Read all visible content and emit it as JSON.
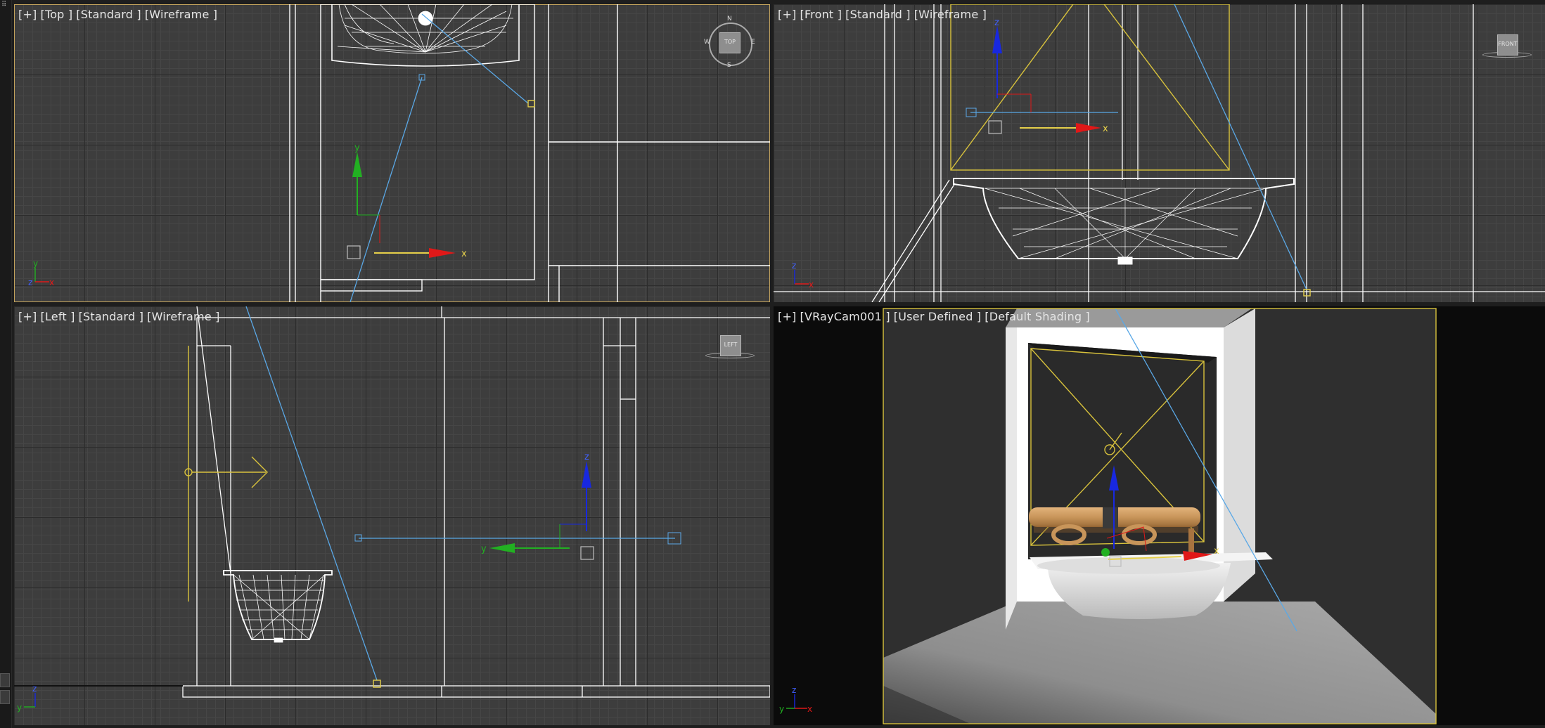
{
  "viewports": {
    "top": {
      "labels": {
        "plus": "[+]",
        "view": "[Top ]",
        "shading_mode": "[Standard ]",
        "display": "[Wireframe ]"
      },
      "viewcube": {
        "face": "TOP",
        "n": "N",
        "s": "S",
        "e": "E",
        "w": "W"
      },
      "tripod": {
        "a": "y",
        "b": "z",
        "c": "x"
      },
      "gizmo": {
        "x": "x",
        "y": "y"
      }
    },
    "front": {
      "labels": {
        "plus": "[+]",
        "view": "[Front ]",
        "shading_mode": "[Standard ]",
        "display": "[Wireframe ]"
      },
      "viewcube": {
        "face": "FRONT"
      },
      "tripod": {
        "a": "z",
        "b": "x",
        "c": ""
      },
      "gizmo": {
        "x": "x",
        "z": "z"
      }
    },
    "left": {
      "labels": {
        "plus": "[+]",
        "view": "[Left ]",
        "shading_mode": "[Standard ]",
        "display": "[Wireframe ]"
      },
      "viewcube": {
        "face": "LEFT"
      },
      "tripod": {
        "a": "z",
        "b": "y",
        "c": ""
      },
      "gizmo": {
        "y": "y",
        "z": "z"
      }
    },
    "camera": {
      "labels": {
        "plus": "[+]",
        "view": "[VRayCam001 ]",
        "shading_mode": "[User Defined ]",
        "display": "[Default Shading ]"
      },
      "tripod": {
        "a": "z",
        "b": "y",
        "c": "x"
      },
      "gizmo": {
        "x": "x"
      }
    }
  },
  "colors": {
    "grid_bg": "#3d3d3d",
    "active_border": "#c2a25c",
    "wireframe": "#ffffff",
    "light_yellow": "#d8c23c",
    "camera_line": "#5aa8e6",
    "axis_x": "#e01818",
    "axis_y": "#22b022",
    "axis_z": "#1828e0",
    "wood": "#c8955a"
  }
}
